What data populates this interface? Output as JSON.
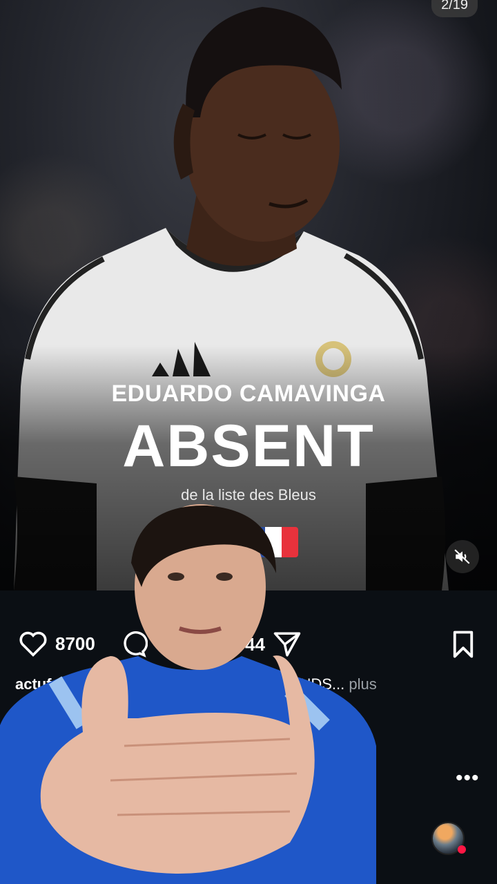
{
  "post": {
    "counter": "2/19",
    "headline_name": "EDUARDO CAMAVINGA",
    "headline_status": "ABSENT",
    "subtitle": "de la liste des Bleus"
  },
  "actions": {
    "likes": "8700",
    "shares": "44"
  },
  "caption": {
    "user": "actuf",
    "text": "GRANDS...",
    "more": "plus"
  },
  "icons": {
    "like": "heart-icon",
    "comment": "comment-icon",
    "share": "send-icon",
    "save": "bookmark-icon",
    "mute": "speaker-muted-icon",
    "options": "more-dots-icon"
  },
  "colors": {
    "background": "#0b0f14",
    "flag_blue": "#2b4ea0",
    "flag_red": "#e8323c",
    "live": "#ff1744"
  }
}
